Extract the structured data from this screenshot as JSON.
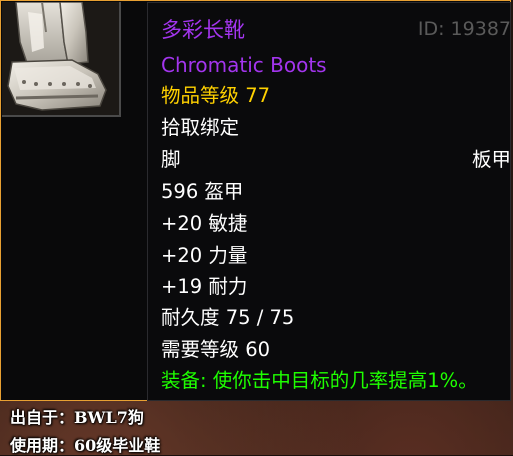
{
  "item": {
    "name_zh": "多彩长靴",
    "name_en": "Chromatic Boots",
    "id_text": "ID: 19387",
    "item_level": "物品等级 77",
    "binding": "拾取绑定",
    "slot": "脚",
    "armor_type": "板甲",
    "armor": "596 盔甲",
    "stats": [
      "+20 敏捷",
      "+20 力量",
      "+19 耐力"
    ],
    "durability": "耐久度 75 / 75",
    "required_level": "需要等级 60",
    "equip_effect": "装备: 使你击中目标的几率提高1%。",
    "icon": "plate-boots-icon"
  },
  "footer": {
    "source": "出自于：BWL7狗",
    "usage": "使用期：60级毕业鞋"
  },
  "colors": {
    "epic": "#a335ee",
    "item_level": "#ffd100",
    "equip": "#1eff00",
    "border": "#e8a032"
  }
}
